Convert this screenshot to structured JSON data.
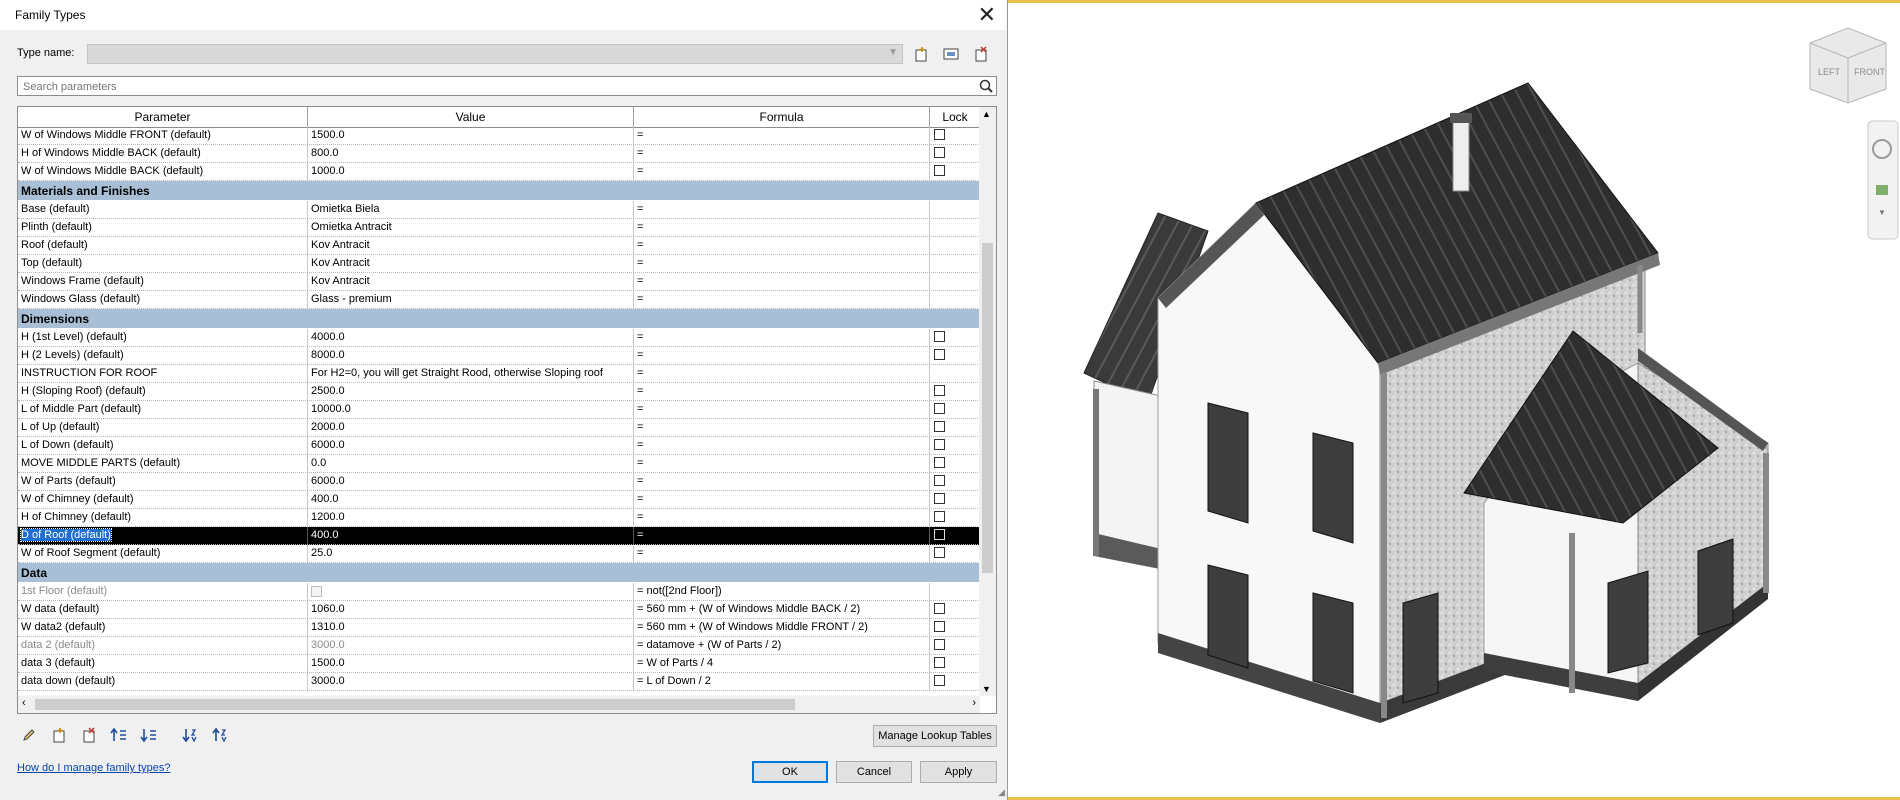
{
  "dialog": {
    "title": "Family Types",
    "type_name_label": "Type name:",
    "type_name_value": "",
    "search_placeholder": "Search parameters",
    "columns": [
      "Parameter",
      "Value",
      "Formula",
      "Lock"
    ],
    "groups": [
      {
        "label": "",
        "rows": [
          {
            "param": "W of Windows Middle FRONT (default)",
            "value": "1500.0",
            "formula": "=",
            "lock": true
          },
          {
            "param": "H of Windows Middle BACK (default)",
            "value": "800.0",
            "formula": "=",
            "lock": true
          },
          {
            "param": "W of Windows Middle BACK (default)",
            "value": "1000.0",
            "formula": "=",
            "lock": true
          }
        ]
      },
      {
        "label": "Materials and Finishes",
        "rows": [
          {
            "param": "Base (default)",
            "value": "Omietka Biela",
            "formula": "=",
            "lock": false
          },
          {
            "param": "Plinth (default)",
            "value": "Omietka Antracit",
            "formula": "=",
            "lock": false
          },
          {
            "param": "Roof (default)",
            "value": "Kov Antracit",
            "formula": "=",
            "lock": false
          },
          {
            "param": "Top (default)",
            "value": "Kov Antracit",
            "formula": "=",
            "lock": false
          },
          {
            "param": "Windows Frame (default)",
            "value": "Kov Antracit",
            "formula": "=",
            "lock": false
          },
          {
            "param": "Windows Glass (default)",
            "value": "Glass - premium",
            "formula": "=",
            "lock": false
          }
        ]
      },
      {
        "label": "Dimensions",
        "rows": [
          {
            "param": "H (1st Level) (default)",
            "value": "4000.0",
            "formula": "=",
            "lock": true
          },
          {
            "param": "H (2 Levels) (default)",
            "value": "8000.0",
            "formula": "=",
            "lock": true
          },
          {
            "param": "INSTRUCTION FOR ROOF",
            "value": "For H2=0, you will get Straight Rood, otherwise Sloping roof",
            "formula": "=",
            "lock": false
          },
          {
            "param": "H (Sloping Roof) (default)",
            "value": "2500.0",
            "formula": "=",
            "lock": true
          },
          {
            "param": "L of Middle Part (default)",
            "value": "10000.0",
            "formula": "=",
            "lock": true
          },
          {
            "param": "L of Up (default)",
            "value": "2000.0",
            "formula": "=",
            "lock": true
          },
          {
            "param": "L of Down (default)",
            "value": "6000.0",
            "formula": "=",
            "lock": true
          },
          {
            "param": "MOVE MIDDLE PARTS (default)",
            "value": "0.0",
            "formula": "=",
            "lock": true
          },
          {
            "param": "W of Parts (default)",
            "value": "6000.0",
            "formula": "=",
            "lock": true
          },
          {
            "param": "W of Chimney (default)",
            "value": "400.0",
            "formula": "=",
            "lock": true
          },
          {
            "param": "H of Chimney (default)",
            "value": "1200.0",
            "formula": "=",
            "lock": true
          },
          {
            "param": "D of Roof (default)",
            "value": "400.0",
            "formula": "=",
            "lock": true,
            "selected": true
          },
          {
            "param": "W of Roof Segment (default)",
            "value": "25.0",
            "formula": "=",
            "lock": true
          }
        ]
      },
      {
        "label": "Data",
        "rows": [
          {
            "param": "1st Floor (default)",
            "value": "",
            "value_checkbox": true,
            "formula": "= not([2nd Floor])",
            "lock": false,
            "dim": true
          },
          {
            "param": "W data (default)",
            "value": "1060.0",
            "formula": "= 560 mm + (W of Windows Middle BACK / 2)",
            "lock": true
          },
          {
            "param": "W data2 (default)",
            "value": "1310.0",
            "formula": "= 560 mm + (W of Windows Middle FRONT / 2)",
            "lock": true
          },
          {
            "param": "data 2 (default)",
            "value": "3000.0",
            "formula": "= datamove + (W of Parts / 2)",
            "lock": true,
            "dim": true
          },
          {
            "param": "data 3 (default)",
            "value": "1500.0",
            "formula": "= W of Parts / 4",
            "lock": true
          },
          {
            "param": "data down (default)",
            "value": "3000.0",
            "formula": "= L of Down / 2",
            "lock": true
          }
        ]
      }
    ],
    "manage_lookup_label": "Manage Lookup Tables",
    "help_link": "How do I manage family types?",
    "ok_label": "OK",
    "cancel_label": "Cancel",
    "apply_label": "Apply"
  },
  "viewcube": {
    "left": "LEFT",
    "front": "FRONT"
  },
  "colors": {
    "group_header": "#a9bfd6",
    "selection": "#000000",
    "viewport_border": "#e8c24a",
    "roof": "#3c3c3c"
  }
}
